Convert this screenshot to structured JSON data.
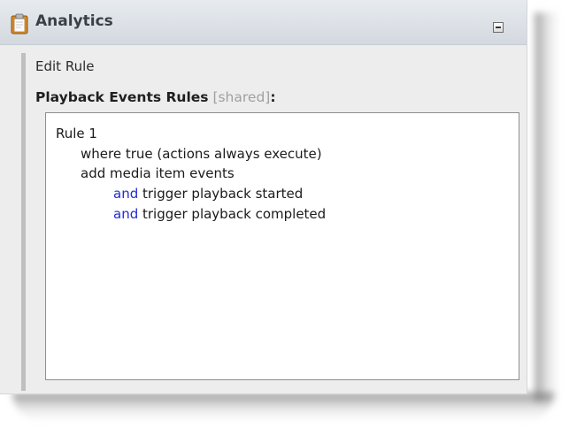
{
  "panel": {
    "title": "Analytics",
    "icon": "clipboard-icon",
    "collapse_icon": "collapse-icon"
  },
  "editor": {
    "edit_label": "Edit Rule",
    "section_title": "Playback Events Rules",
    "shared_tag": "[shared]",
    "colon": ":"
  },
  "rule": {
    "name": "Rule 1",
    "condition": "where true (actions always execute)",
    "action": "add media item events",
    "triggers": [
      {
        "keyword": "and",
        "text": " trigger playback started"
      },
      {
        "keyword": "and",
        "text": " trigger playback completed"
      }
    ]
  },
  "colors": {
    "keyword": "#1f2bd6",
    "shared_tag": "#a0a0a0",
    "header_bg": "#dfe4ea"
  }
}
